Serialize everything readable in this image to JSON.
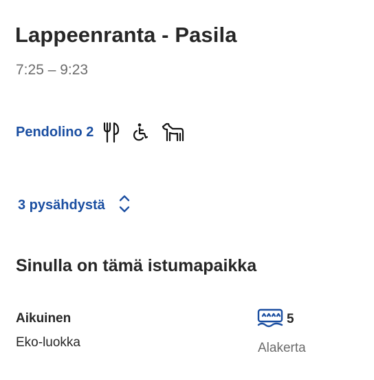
{
  "journey": {
    "route": "Lappeenranta - Pasila",
    "time": "7:25 – 9:23"
  },
  "train": {
    "name": "Pendolino 2",
    "services": [
      "restaurant-icon",
      "wheelchair-icon",
      "pet-icon"
    ]
  },
  "stops": {
    "label": "3 pysähdystä",
    "toggle_icon": "chevron-up-down-icon"
  },
  "seat_section": {
    "title": "Sinulla on tämä istumapaikka",
    "passenger_type": "Aikuinen",
    "ticket_class": "Eko-luokka",
    "seat_icon": "seat-icon",
    "seat_number": "5",
    "deck": "Alakerta"
  },
  "colors": {
    "accent": "#1a4ea1",
    "text": "#262626",
    "muted": "#6b6b6b"
  }
}
